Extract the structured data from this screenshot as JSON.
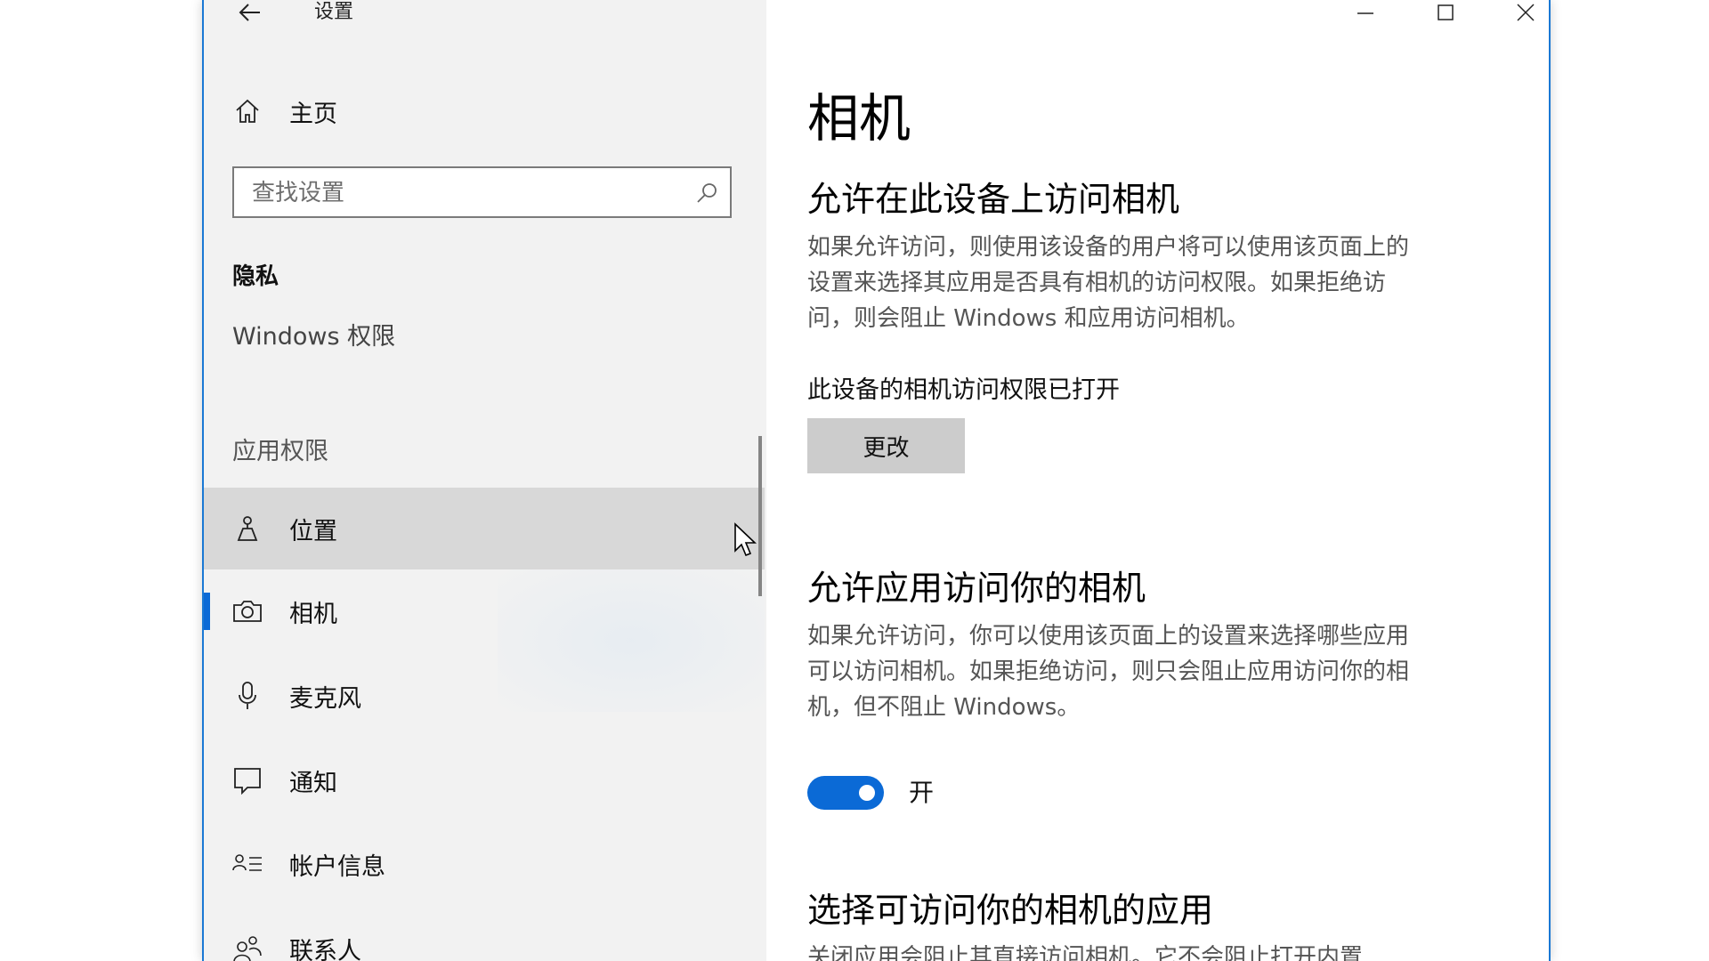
{
  "window": {
    "title": "设置",
    "accent_color": "#0b6ad6",
    "controls": [
      "minimize-icon",
      "maximize-icon",
      "close-icon"
    ]
  },
  "sidebar": {
    "home_label": "主页",
    "search_placeholder": "查找设置",
    "privacy_heading": "隐私",
    "windows_permissions": "Windows 权限",
    "app_permissions_heading": "应用权限",
    "items": [
      {
        "label": "位置",
        "icon": "location-icon",
        "state": "hover"
      },
      {
        "label": "相机",
        "icon": "camera-icon",
        "state": "selected"
      },
      {
        "label": "麦克风",
        "icon": "microphone-icon",
        "state": "normal"
      },
      {
        "label": "通知",
        "icon": "notification-icon",
        "state": "normal"
      },
      {
        "label": "帐户信息",
        "icon": "account-info-icon",
        "state": "normal"
      },
      {
        "label": "联系人",
        "icon": "contacts-icon",
        "state": "normal"
      }
    ]
  },
  "main": {
    "page_title": "相机",
    "device_access": {
      "title": "允许在此设备上访问相机",
      "description_lines": [
        "如果允许访问，则使用该设备的用户将可以使用该页面上的",
        "设置来选择其应用是否具有相机的访问权限。如果拒绝访",
        "问，则会阻止 Windows 和应用访问相机。"
      ],
      "status": "此设备的相机访问权限已打开",
      "change_button": "更改"
    },
    "app_access": {
      "title": "允许应用访问你的相机",
      "description_lines": [
        "如果允许访问，你可以使用该页面上的设置来选择哪些应用",
        "可以访问相机。如果拒绝访问，则只会阻止应用访问你的相",
        "机，但不阻止 Windows。"
      ],
      "toggle_state_label": "开",
      "toggle_on": true
    },
    "choose_apps": {
      "title": "选择可访问你的相机的应用",
      "description_partial": "关闭应用会阻止其直接访问相机。它不会阻止打开内置"
    }
  }
}
